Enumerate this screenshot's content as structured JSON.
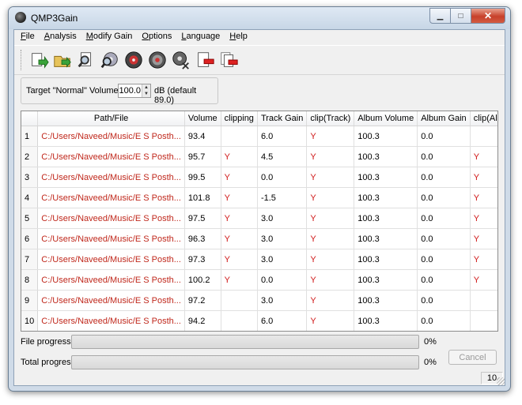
{
  "window": {
    "title": "QMP3Gain"
  },
  "menu": [
    {
      "label": "File",
      "key": "F",
      "rest": "ile"
    },
    {
      "label": "Analysis",
      "key": "A",
      "rest": "nalysis"
    },
    {
      "label": "Modify Gain",
      "key": "M",
      "rest": "odify Gain"
    },
    {
      "label": "Options",
      "key": "O",
      "rest": "ptions"
    },
    {
      "label": "Language",
      "key": "L",
      "rest": "anguage"
    },
    {
      "label": "Help",
      "key": "H",
      "rest": "elp"
    }
  ],
  "toolbar": [
    {
      "name": "add-files-icon"
    },
    {
      "name": "add-folder-icon"
    },
    {
      "name": "track-analysis-icon"
    },
    {
      "name": "album-analysis-icon"
    },
    {
      "name": "track-gain-icon"
    },
    {
      "name": "album-gain-icon"
    },
    {
      "name": "constant-gain-icon"
    },
    {
      "name": "clear-selected-icon"
    },
    {
      "name": "clear-all-icon"
    }
  ],
  "target": {
    "label": "Target \"Normal\" Volume:",
    "value": "100.0",
    "suffix": "dB (default 89.0)"
  },
  "table": {
    "headers": [
      "Path/File",
      "Volume",
      "clipping",
      "Track Gain",
      "clip(Track)",
      "Album Volume",
      "Album Gain",
      "clip(Album)"
    ],
    "rows": [
      [
        "1",
        "C:/Users/Naveed/Music/E S Posth...",
        "93.4",
        "",
        "6.0",
        "Y",
        "100.3",
        "0.0",
        ""
      ],
      [
        "2",
        "C:/Users/Naveed/Music/E S Posth...",
        "95.7",
        "Y",
        "4.5",
        "Y",
        "100.3",
        "0.0",
        "Y"
      ],
      [
        "3",
        "C:/Users/Naveed/Music/E S Posth...",
        "99.5",
        "Y",
        "0.0",
        "Y",
        "100.3",
        "0.0",
        "Y"
      ],
      [
        "4",
        "C:/Users/Naveed/Music/E S Posth...",
        "101.8",
        "Y",
        "-1.5",
        "Y",
        "100.3",
        "0.0",
        "Y"
      ],
      [
        "5",
        "C:/Users/Naveed/Music/E S Posth...",
        "97.5",
        "Y",
        "3.0",
        "Y",
        "100.3",
        "0.0",
        "Y"
      ],
      [
        "6",
        "C:/Users/Naveed/Music/E S Posth...",
        "96.3",
        "Y",
        "3.0",
        "Y",
        "100.3",
        "0.0",
        "Y"
      ],
      [
        "7",
        "C:/Users/Naveed/Music/E S Posth...",
        "97.3",
        "Y",
        "3.0",
        "Y",
        "100.3",
        "0.0",
        "Y"
      ],
      [
        "8",
        "C:/Users/Naveed/Music/E S Posth...",
        "100.2",
        "Y",
        "0.0",
        "Y",
        "100.3",
        "0.0",
        "Y"
      ],
      [
        "9",
        "C:/Users/Naveed/Music/E S Posth...",
        "97.2",
        "",
        "3.0",
        "Y",
        "100.3",
        "0.0",
        ""
      ],
      [
        "10",
        "C:/Users/Naveed/Music/E S Posth...",
        "94.2",
        "",
        "6.0",
        "Y",
        "100.3",
        "0.0",
        ""
      ]
    ]
  },
  "progress": {
    "file": {
      "label": "File progress",
      "value": 0,
      "text": "0%"
    },
    "total": {
      "label": "Total progress",
      "value": 0,
      "text": "0%"
    }
  },
  "cancel_label": "Cancel",
  "status": {
    "count": "10"
  },
  "colors": {
    "flag": "#d01818",
    "path": "#c0281c",
    "progress_fill": "#33b447"
  }
}
